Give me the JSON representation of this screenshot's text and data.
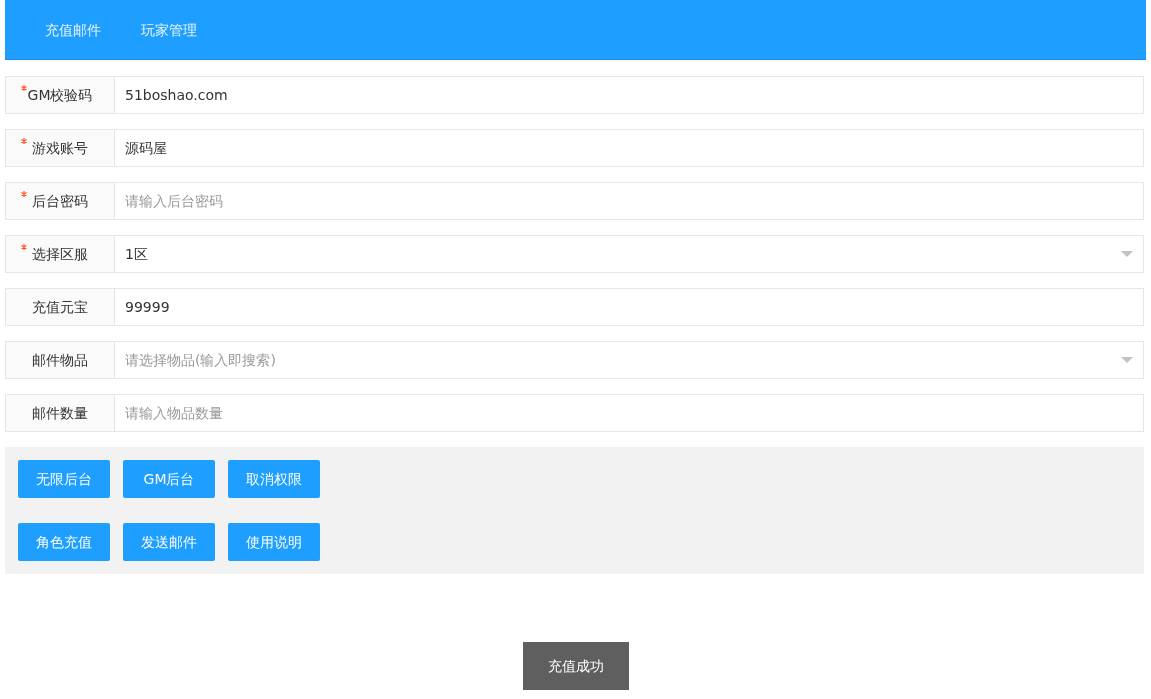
{
  "nav": {
    "tabs": [
      {
        "label": "充值邮件"
      },
      {
        "label": "玩家管理"
      }
    ]
  },
  "form": {
    "fields": [
      {
        "kind": "input",
        "label": "GM校验码",
        "required": true,
        "value": "51boshao.com"
      },
      {
        "kind": "input",
        "label": "游戏账号",
        "required": true,
        "value": "源码屋"
      },
      {
        "kind": "input",
        "label": "后台密码",
        "required": true,
        "placeholder": "请输入后台密码"
      },
      {
        "kind": "select",
        "label": "选择区服",
        "required": true,
        "value": "1区"
      },
      {
        "kind": "input",
        "label": "充值元宝",
        "required": false,
        "value": "99999"
      },
      {
        "kind": "select",
        "label": "邮件物品",
        "required": false,
        "placeholder": "请选择物品(输入即搜索)"
      },
      {
        "kind": "input",
        "label": "邮件数量",
        "required": false,
        "placeholder": "请输入物品数量"
      }
    ]
  },
  "actions": [
    [
      "无限后台",
      "GM后台",
      "取消权限"
    ],
    [
      "角色充值",
      "发送邮件",
      "使用说明"
    ]
  ],
  "toast": {
    "text": "充值成功"
  }
}
